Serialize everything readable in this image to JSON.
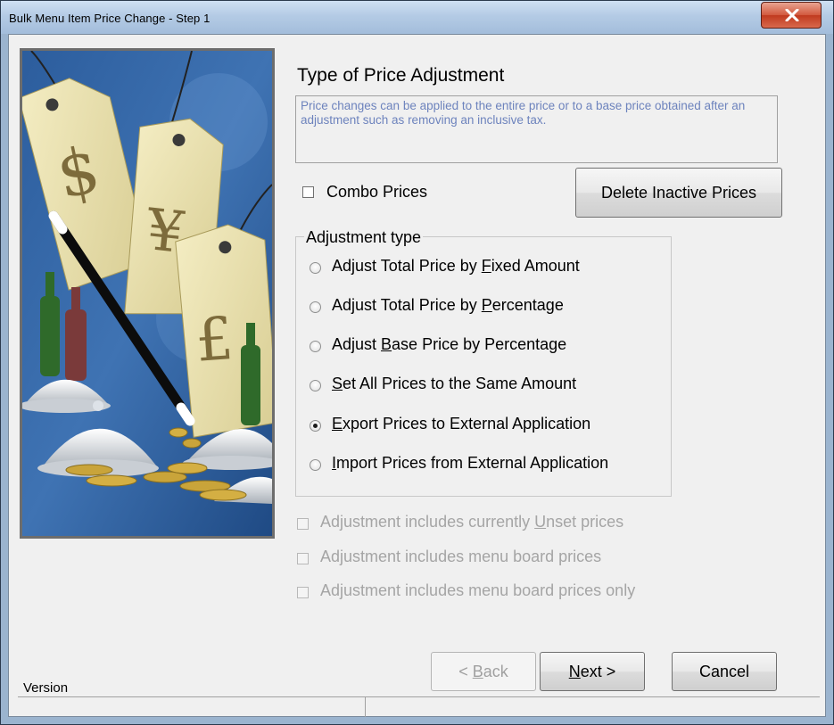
{
  "window": {
    "title": "Bulk Menu Item Price Change  -  Step 1"
  },
  "page": {
    "heading": "Type of Price Adjustment",
    "description": "Price changes can be applied to the entire price or to a base price obtained after an adjustment such as removing an inclusive tax."
  },
  "combo_prices": {
    "label": "Combo Prices",
    "checked": false
  },
  "delete_inactive_label": "Delete Inactive Prices",
  "adjustment_type": {
    "title": "Adjustment type",
    "options": [
      {
        "before": "Adjust Total Price by ",
        "accel": "F",
        "after": "ixed Amount",
        "checked": false
      },
      {
        "before": "Adjust Total Price by ",
        "accel": "P",
        "after": "ercentage",
        "checked": false
      },
      {
        "before": "Adjust ",
        "accel": "B",
        "after": "ase Price by Percentage",
        "checked": false
      },
      {
        "before": "",
        "accel": "S",
        "after": "et All Prices to the Same Amount",
        "checked": false
      },
      {
        "before": "",
        "accel": "E",
        "after": "xport Prices to External Application",
        "checked": true
      },
      {
        "before": "",
        "accel": "I",
        "after": "mport Prices from External Application",
        "checked": false
      }
    ]
  },
  "disabled_options": [
    {
      "before": "Adjustment includes currently ",
      "accel": "U",
      "after": "nset prices"
    },
    {
      "before": "Adjustment includes menu board prices",
      "accel": "",
      "after": ""
    },
    {
      "before": "Adjustment includes menu board prices only",
      "accel": "",
      "after": ""
    }
  ],
  "buttons": {
    "back": {
      "before": "< ",
      "accel": "B",
      "after": "ack"
    },
    "next": {
      "before": "",
      "accel": "N",
      "after": "ext >"
    },
    "cancel": "Cancel"
  },
  "status": {
    "version_label": "Version"
  },
  "icons": {
    "close": "close-icon",
    "artwork": "price-tags-magic-wand-illustration"
  },
  "colors": {
    "description_text": "#6d83bd",
    "close_button": "#c8472b",
    "titlebar": "#b4cbe5"
  }
}
